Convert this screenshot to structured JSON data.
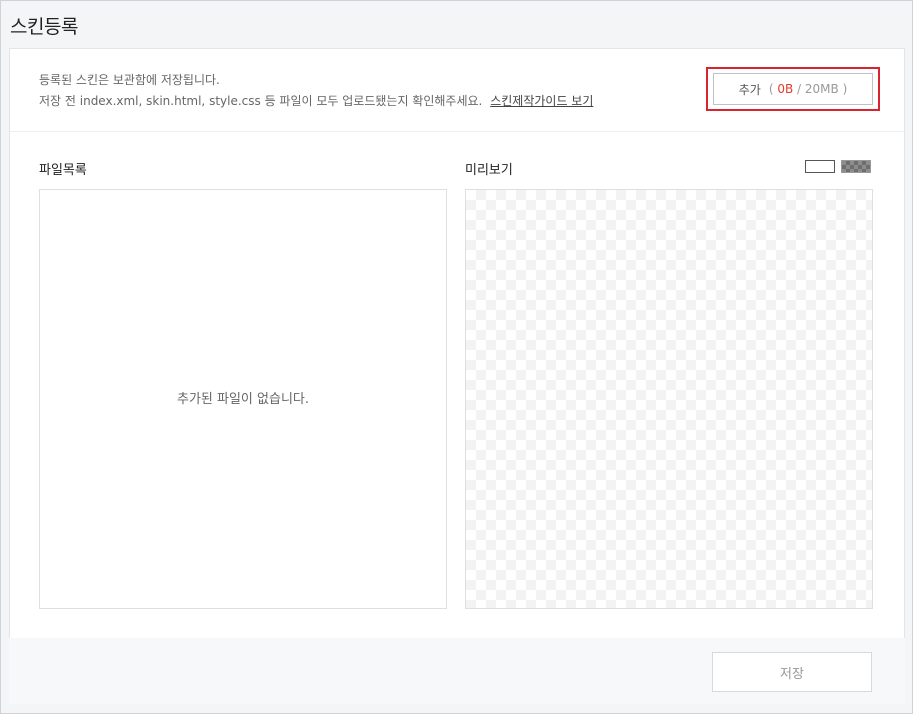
{
  "page": {
    "title": "스킨등록"
  },
  "info": {
    "line1": "등록된 스킨은 보관함에 저장됩니다.",
    "line2": "저장 전 index.xml, skin.html, style.css 등 파일이 모두 업로드됐는지 확인해주세요.",
    "guide_link": "스킨제작가이드 보기"
  },
  "add_button": {
    "label": "추가",
    "open": "(",
    "count": "0B",
    "limit": "/ 20MB )"
  },
  "file_list": {
    "label": "파일목록",
    "empty_message": "추가된 파일이 없습니다."
  },
  "preview": {
    "label": "미리보기",
    "backgrounds": [
      "white",
      "checkered"
    ]
  },
  "footer": {
    "save_label": "저장"
  },
  "colors": {
    "highlight": "#d9242f",
    "count": "#e8382c"
  }
}
